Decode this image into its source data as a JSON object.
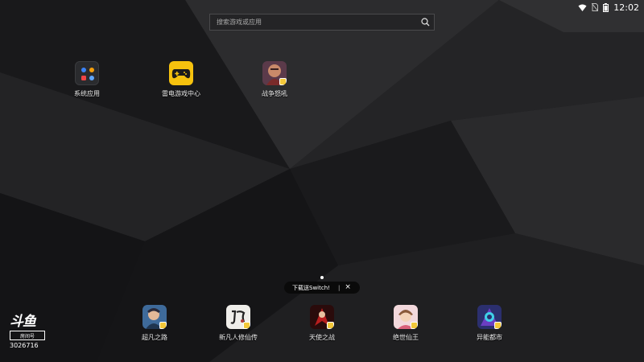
{
  "status": {
    "time": "12:02",
    "wifi_icon": "wifi-icon",
    "sim_icon": "no-sim-icon",
    "battery_icon": "battery-icon"
  },
  "search": {
    "placeholder": "搜索游戏或应用"
  },
  "desktop_apps": [
    {
      "label": "系统应用",
      "icon": "app-folder-icon"
    },
    {
      "label": "雷电游戏中心",
      "icon": "gamepad-icon"
    },
    {
      "label": "战争怒吼",
      "icon": "game-art-icon"
    }
  ],
  "dock_apps": [
    {
      "label": "超凡之路",
      "icon": "game-art-icon"
    },
    {
      "label": "新凡人修仙传",
      "icon": "game-art-icon"
    },
    {
      "label": "天使之战",
      "icon": "game-art-icon"
    },
    {
      "label": "绝世仙王",
      "icon": "game-art-icon"
    },
    {
      "label": "异能都市",
      "icon": "game-art-icon"
    }
  ],
  "tooltip": {
    "text": "下载送Switch!",
    "separator": "|",
    "close": "×"
  },
  "watermark": {
    "logo": "斗鱼",
    "tag": "房间号",
    "room": "3026716"
  },
  "colors": {
    "background": "#1b1b1d",
    "accent_yellow": "#f6c20e"
  }
}
